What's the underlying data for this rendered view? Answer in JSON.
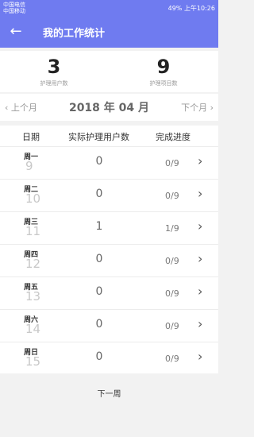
{
  "status_bar": {
    "carrier1": "中国电信",
    "carrier2": "中国移动",
    "battery": "49%",
    "time": "上午10:26"
  },
  "app_bar": {
    "back_icon": "arrow-left-icon",
    "title": "我的工作统计"
  },
  "summary": {
    "patients_count": "3",
    "patients_label": "护理用户数",
    "items_count": "9",
    "items_label": "护理项目数"
  },
  "month_nav": {
    "prev": "上个月",
    "current": "2018 年 04 月",
    "next": "下个月"
  },
  "table": {
    "headers": [
      "日期",
      "实际护理用户数",
      "完成进度"
    ],
    "rows": [
      {
        "week": "周一",
        "day": "9",
        "count": "0",
        "progress": "0/9"
      },
      {
        "week": "周二",
        "day": "10",
        "count": "0",
        "progress": "0/9"
      },
      {
        "week": "周三",
        "day": "11",
        "count": "1",
        "progress": "1/9"
      },
      {
        "week": "周四",
        "day": "12",
        "count": "0",
        "progress": "0/9"
      },
      {
        "week": "周五",
        "day": "13",
        "count": "0",
        "progress": "0/9"
      },
      {
        "week": "周六",
        "day": "14",
        "count": "0",
        "progress": "0/9"
      },
      {
        "week": "周日",
        "day": "15",
        "count": "0",
        "progress": "0/9"
      }
    ]
  },
  "footer": {
    "next_week": "下一周"
  },
  "colors": {
    "accent": "#6f7bf0"
  }
}
